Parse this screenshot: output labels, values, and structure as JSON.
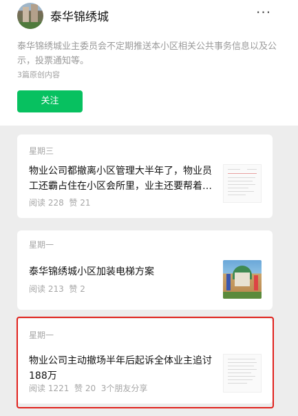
{
  "account": {
    "name": "泰华锦绣城",
    "description": "泰华锦绣城业主委员会不定期推送本小区相关公共事务信息以及公示，投票通知等。",
    "original_count": "3篇原创内容",
    "follow_label": "关注",
    "more_icon": "more-dots-icon"
  },
  "articles": [
    {
      "day": "星期三",
      "title": "物业公司都撤离小区管理大半年了，物业员工还霸占住在小区会所里，业主还要帮着…",
      "reads": "阅读 228",
      "likes": "赞 21",
      "shares": "",
      "thumb": "document"
    },
    {
      "day": "星期一",
      "title": "泰华锦绣城小区加装电梯方案",
      "reads": "阅读 213",
      "likes": "赞 2",
      "shares": "",
      "thumb": "photo"
    },
    {
      "day": "星期一",
      "title": "物业公司主动撤场半年后起诉全体业主追讨188万",
      "reads": "阅读 1221",
      "likes": "赞 20",
      "shares": "3个朋友分享",
      "thumb": "document"
    }
  ],
  "colors": {
    "accent": "#07c160",
    "highlight": "#e0201b",
    "feed_bg": "#ededed"
  }
}
